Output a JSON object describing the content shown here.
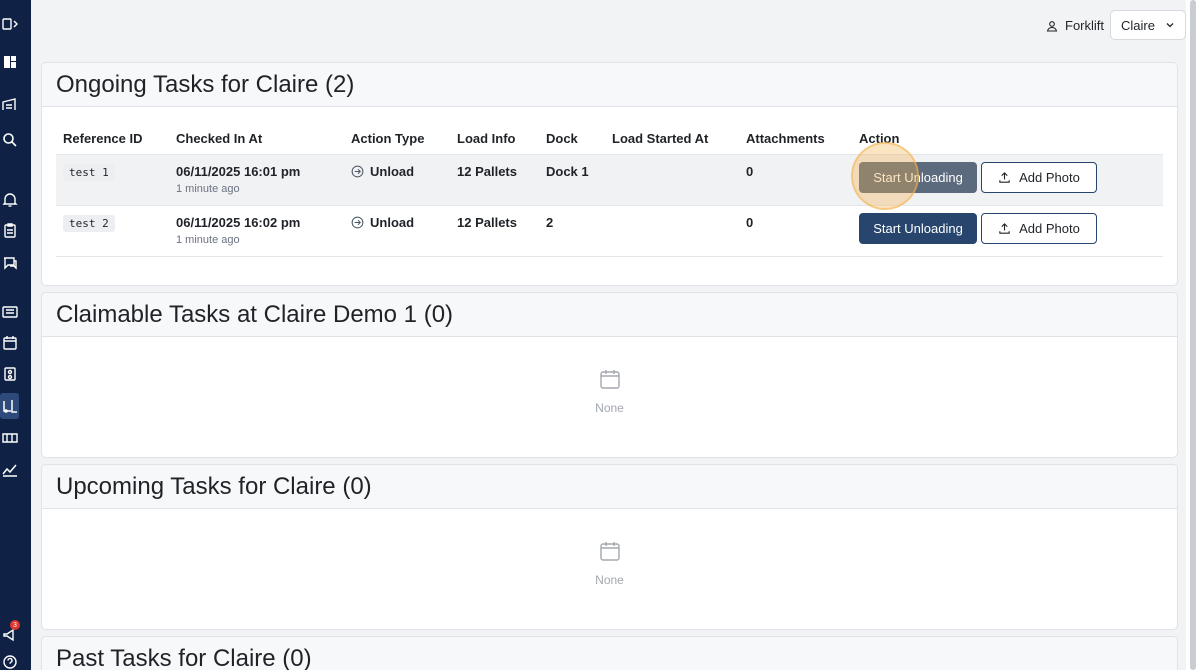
{
  "header": {
    "role": "Forklift",
    "user": "Claire"
  },
  "sidebar": {
    "notification_count": "3"
  },
  "ongoing": {
    "title": "Ongoing Tasks for Claire (2)",
    "columns": [
      "Reference ID",
      "Checked In At",
      "Action Type",
      "Load Info",
      "Dock",
      "Load Started At",
      "Attachments",
      "Action"
    ],
    "rows": [
      {
        "ref": "test 1",
        "checked_in": "06/11/2025 16:01 pm",
        "checked_ago": "1 minute ago",
        "action_type": "Unload",
        "load_info": "12 Pallets",
        "dock": "Dock 1",
        "load_started": "",
        "attachments": "0",
        "primary_action": "Start Unloading",
        "secondary_action": "Add Photo"
      },
      {
        "ref": "test 2",
        "checked_in": "06/11/2025 16:02 pm",
        "checked_ago": "1 minute ago",
        "action_type": "Unload",
        "load_info": "12 Pallets",
        "dock": "2",
        "load_started": "",
        "attachments": "0",
        "primary_action": "Start Unloading",
        "secondary_action": "Add Photo"
      }
    ]
  },
  "claimable": {
    "title": "Claimable Tasks at Claire Demo 1 (0)",
    "empty_text": "None"
  },
  "upcoming": {
    "title": "Upcoming Tasks for Claire (0)",
    "empty_text": "None"
  },
  "past": {
    "title": "Past Tasks for Claire (0)"
  }
}
